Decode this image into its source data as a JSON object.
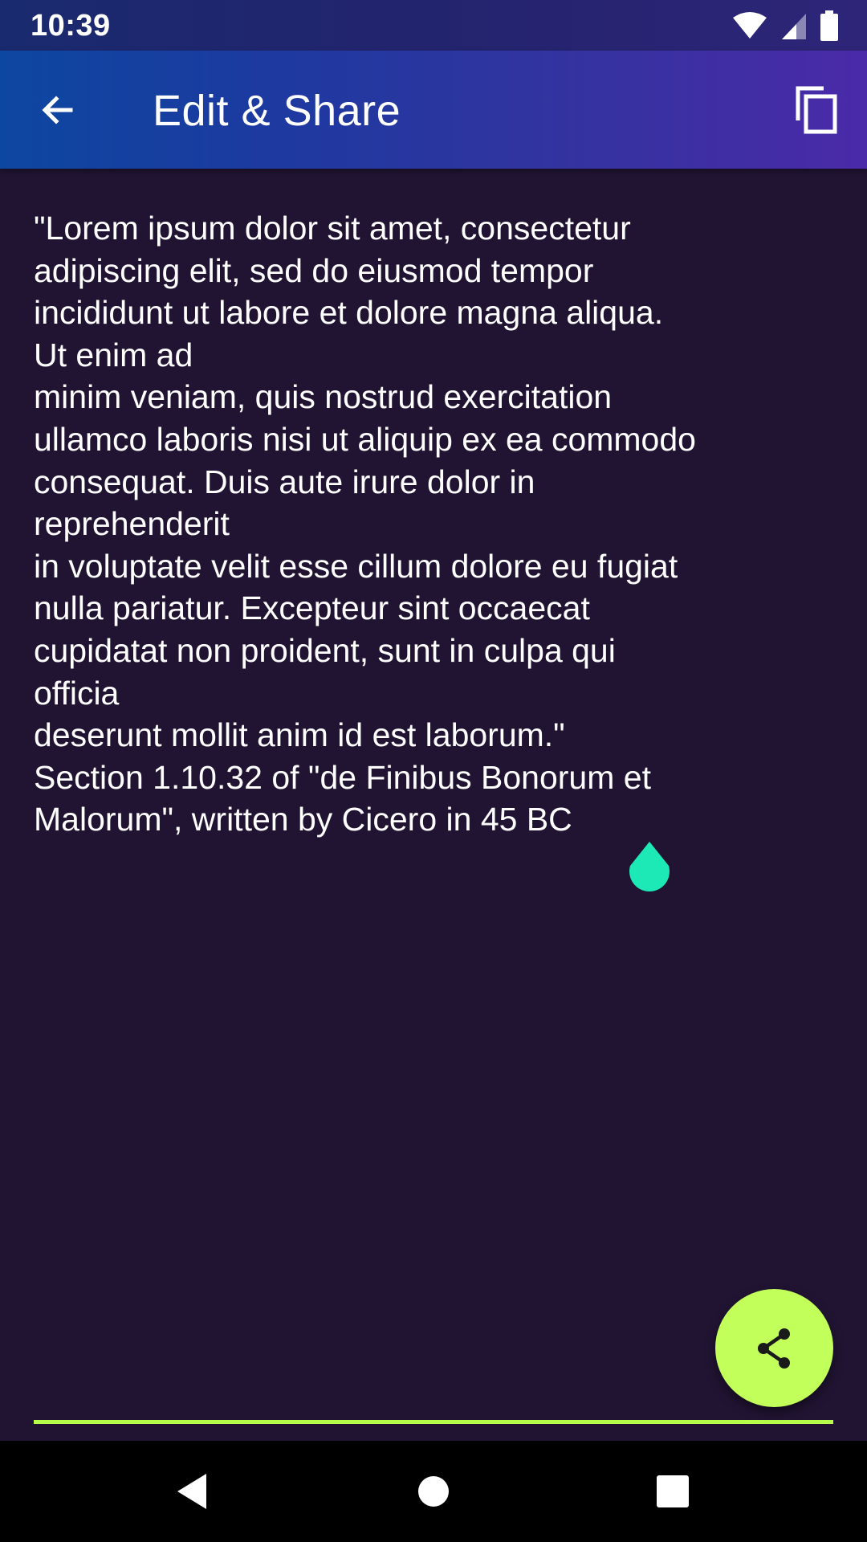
{
  "status_bar": {
    "time": "10:39",
    "icons": [
      "wifi-icon",
      "cell-signal-icon",
      "battery-icon"
    ]
  },
  "app_bar": {
    "title": "Edit & Share",
    "back_icon": "arrow-back-icon",
    "copy_icon": "content-copy-icon"
  },
  "editor": {
    "text": "\"Lorem ipsum dolor sit amet, consectetur\nadipiscing elit, sed do eiusmod tempor\nincididunt ut labore et dolore magna aliqua.\nUt enim ad\nminim veniam, quis nostrud exercitation\nullamco laboris nisi ut aliquip ex ea commodo\nconsequat. Duis aute irure dolor in\nreprehenderit\nin voluptate velit esse cillum dolore eu fugiat\nnulla pariatur. Excepteur sint occaecat\ncupidatat non proident, sunt in culpa qui\nofficia\ndeserunt mollit anim id est laborum.\"\nSection 1.10.32 of \"de Finibus Bonorum et\nMalorum\", written by Cicero in 45 BC"
  },
  "fab": {
    "icon": "share-icon"
  },
  "colors": {
    "background": "#211433",
    "accent": "#c3ff5a",
    "cursor_handle": "#1de9b6",
    "underline": "#b6ff4a"
  },
  "nav_bar": {
    "icons": [
      "nav-back-icon",
      "nav-home-icon",
      "nav-recents-icon"
    ]
  }
}
